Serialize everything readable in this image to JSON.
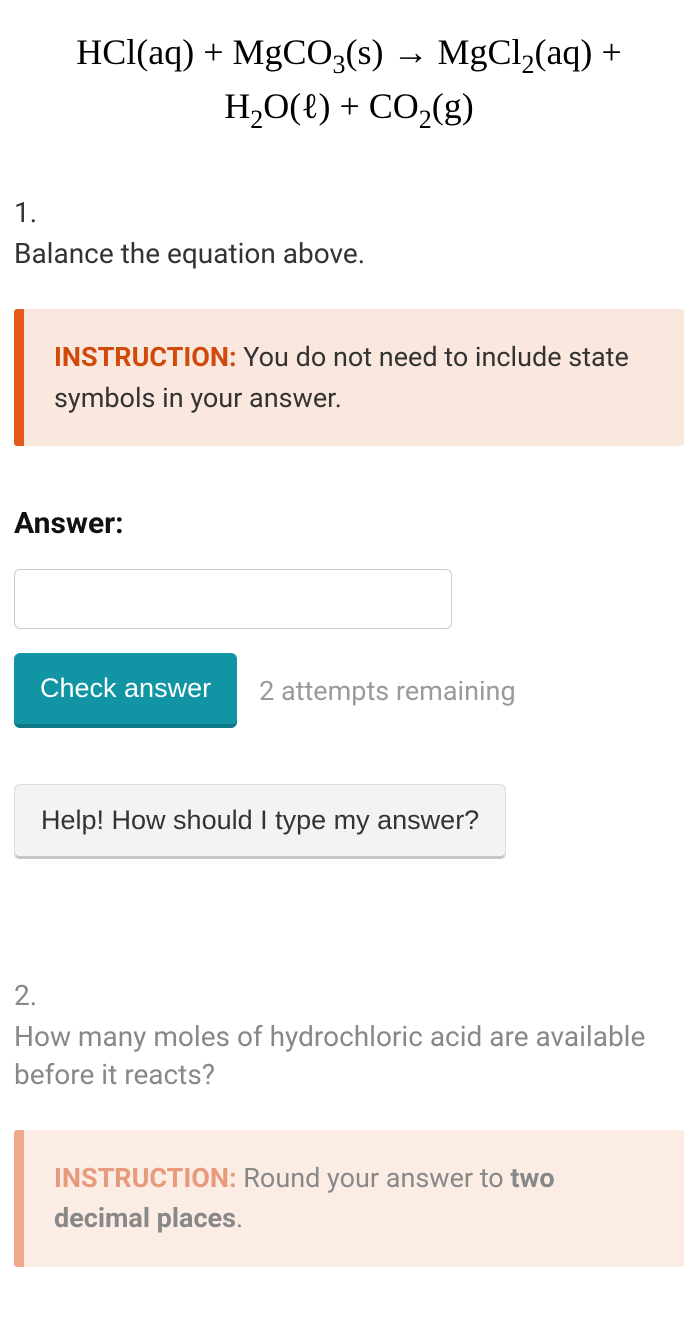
{
  "equation": {
    "line1_html": "HCl(aq) + MgCO<sub class='sub'>3</sub>(s) → MgCl<sub class='sub'>2</sub>(aq) +",
    "line2_html": "H<sub class='sub'>2</sub>O(ℓ) + CO<sub class='sub'>2</sub>(g)"
  },
  "q1": {
    "number": "1.",
    "text": "Balance the equation above.",
    "instruction_label": "INSTRUCTION:",
    "instruction_body": " You do not need to include state symbols in your answer.",
    "answer_label": "Answer:",
    "answer_value": "",
    "check_label": "Check answer",
    "attempts": "2 attempts remaining",
    "help_label": "Help! How should I type my answer?"
  },
  "q2": {
    "number": "2.",
    "text": "How many moles of hydrochloric acid are available before it reacts?",
    "instruction_label": "INSTRUCTION:",
    "instruction_body_prefix": " Round your answer to ",
    "instruction_body_bold": "two decimal places",
    "instruction_body_suffix": "."
  }
}
